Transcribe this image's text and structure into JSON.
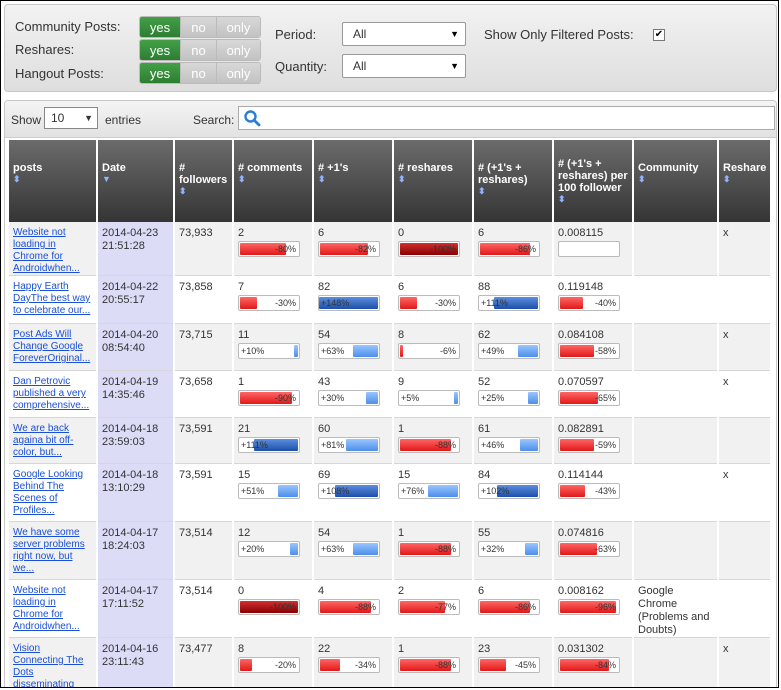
{
  "filters": {
    "community_posts": {
      "label": "Community Posts:",
      "yes": "yes",
      "no": "no",
      "only": "only"
    },
    "reshares": {
      "label": "Reshares:",
      "yes": "yes",
      "no": "no",
      "only": "only"
    },
    "hangout_posts": {
      "label": "Hangout Posts:",
      "yes": "yes",
      "no": "no",
      "only": "only"
    },
    "period": {
      "label": "Period:",
      "value": "All"
    },
    "quantity": {
      "label": "Quantity:",
      "value": "All"
    },
    "show_only_filtered": {
      "label": "Show Only Filtered Posts:",
      "checked": true,
      "check_glyph": "✔"
    }
  },
  "table_controls": {
    "show_label": "Show",
    "entries_value": "10",
    "entries_label": "entries",
    "search_label": "Search:",
    "search_value": ""
  },
  "columns": {
    "posts": "posts",
    "date": "Date",
    "followers": "# followers",
    "comments": "# comments",
    "plus1": "# +1's",
    "reshares": "# reshares",
    "plus1_reshares": "# (+1's + reshares)",
    "per100": "# (+1's + reshares) per 100 follower",
    "community": "Community",
    "reshare": "Reshare"
  },
  "rows": [
    {
      "post": "Website not loading in Chrome for Androidwhen...",
      "date": "2014-04-23",
      "time": "21:51:28",
      "followers": "73,933",
      "comments": {
        "value": "2",
        "pct": -80,
        "label": "-80%"
      },
      "plus1": {
        "value": "6",
        "pct": -82,
        "label": "-82%"
      },
      "reshares": {
        "value": "0",
        "pct": -100,
        "label": "-100%"
      },
      "pr": {
        "value": "6",
        "pct": -86,
        "label": "-86%"
      },
      "per100": {
        "value": "0.008115",
        "pct": 0,
        "label": ""
      },
      "community": "",
      "reshare": "x"
    },
    {
      "post": "Happy Earth DayThe best way to celebrate our...",
      "date": "2014-04-22",
      "time": "20:55:17",
      "followers": "73,858",
      "comments": {
        "value": "7",
        "pct": -30,
        "label": "-30%"
      },
      "plus1": {
        "value": "82",
        "pct": 148,
        "label": "+148%"
      },
      "reshares": {
        "value": "6",
        "pct": -30,
        "label": "-30%"
      },
      "pr": {
        "value": "88",
        "pct": 111,
        "label": "+111%"
      },
      "per100": {
        "value": "0.119148",
        "pct": -40,
        "label": "-40%"
      },
      "community": "",
      "reshare": ""
    },
    {
      "post": "Post Ads Will Change Google ForeverOriginal...",
      "date": "2014-04-20",
      "time": "08:54:40",
      "followers": "73,715",
      "comments": {
        "value": "11",
        "pct": 10,
        "label": "+10%"
      },
      "plus1": {
        "value": "54",
        "pct": 63,
        "label": "+63%"
      },
      "reshares": {
        "value": "8",
        "pct": -6,
        "label": "-6%"
      },
      "pr": {
        "value": "62",
        "pct": 49,
        "label": "+49%"
      },
      "per100": {
        "value": "0.084108",
        "pct": -58,
        "label": "-58%"
      },
      "community": "",
      "reshare": "x"
    },
    {
      "post": "Dan Petrovic published a very comprehensive...",
      "date": "2014-04-19",
      "time": "14:35:46",
      "followers": "73,658",
      "comments": {
        "value": "1",
        "pct": -90,
        "label": "-90%"
      },
      "plus1": {
        "value": "43",
        "pct": 30,
        "label": "+30%"
      },
      "reshares": {
        "value": "9",
        "pct": 5,
        "label": "+5%"
      },
      "pr": {
        "value": "52",
        "pct": 25,
        "label": "+25%"
      },
      "per100": {
        "value": "0.070597",
        "pct": -65,
        "label": "-65%"
      },
      "community": "",
      "reshare": "x"
    },
    {
      "post": "We are back againa bit off-color, but...",
      "date": "2014-04-18",
      "time": "23:59:03",
      "followers": "73,591",
      "comments": {
        "value": "21",
        "pct": 111,
        "label": "+111%"
      },
      "plus1": {
        "value": "60",
        "pct": 81,
        "label": "+81%"
      },
      "reshares": {
        "value": "1",
        "pct": -88,
        "label": "-88%"
      },
      "pr": {
        "value": "61",
        "pct": 46,
        "label": "+46%"
      },
      "per100": {
        "value": "0.082891",
        "pct": -59,
        "label": "-59%"
      },
      "community": "",
      "reshare": ""
    },
    {
      "post": "Google Looking Behind The Scenes of Profiles...",
      "date": "2014-04-18",
      "time": "13:10:29",
      "followers": "73,591",
      "comments": {
        "value": "15",
        "pct": 51,
        "label": "+51%"
      },
      "plus1": {
        "value": "69",
        "pct": 108,
        "label": "+108%"
      },
      "reshares": {
        "value": "15",
        "pct": 76,
        "label": "+76%"
      },
      "pr": {
        "value": "84",
        "pct": 102,
        "label": "+102%"
      },
      "per100": {
        "value": "0.114144",
        "pct": -43,
        "label": "-43%"
      },
      "community": "",
      "reshare": "x"
    },
    {
      "post": "We have some server problems right now, but we...",
      "date": "2014-04-17",
      "time": "18:24:03",
      "followers": "73,514",
      "comments": {
        "value": "12",
        "pct": 20,
        "label": "+20%"
      },
      "plus1": {
        "value": "54",
        "pct": 63,
        "label": "+63%"
      },
      "reshares": {
        "value": "1",
        "pct": -88,
        "label": "-88%"
      },
      "pr": {
        "value": "55",
        "pct": 32,
        "label": "+32%"
      },
      "per100": {
        "value": "0.074816",
        "pct": -63,
        "label": "-63%"
      },
      "community": "",
      "reshare": ""
    },
    {
      "post": "Website not loading in Chrome for Androidwhen...",
      "date": "2014-04-17",
      "time": "17:11:52",
      "followers": "73,514",
      "comments": {
        "value": "0",
        "pct": -100,
        "label": "-100%"
      },
      "plus1": {
        "value": "4",
        "pct": -88,
        "label": "-88%"
      },
      "reshares": {
        "value": "2",
        "pct": -77,
        "label": "-77%"
      },
      "pr": {
        "value": "6",
        "pct": -86,
        "label": "-86%"
      },
      "per100": {
        "value": "0.008162",
        "pct": -96,
        "label": "-96%"
      },
      "community": "Google Chrome (Problems and Doubts)",
      "reshare": ""
    },
    {
      "post": "Vision Connecting The Dots disseminating seeds...",
      "date": "2014-04-16",
      "time": "23:11:43",
      "followers": "73,477",
      "comments": {
        "value": "8",
        "pct": -20,
        "label": "-20%"
      },
      "plus1": {
        "value": "22",
        "pct": -34,
        "label": "-34%"
      },
      "reshares": {
        "value": "1",
        "pct": -88,
        "label": "-88%"
      },
      "pr": {
        "value": "23",
        "pct": -45,
        "label": "-45%"
      },
      "per100": {
        "value": "0.031302",
        "pct": -84,
        "label": "-84%"
      },
      "community": "",
      "reshare": "x"
    }
  ]
}
